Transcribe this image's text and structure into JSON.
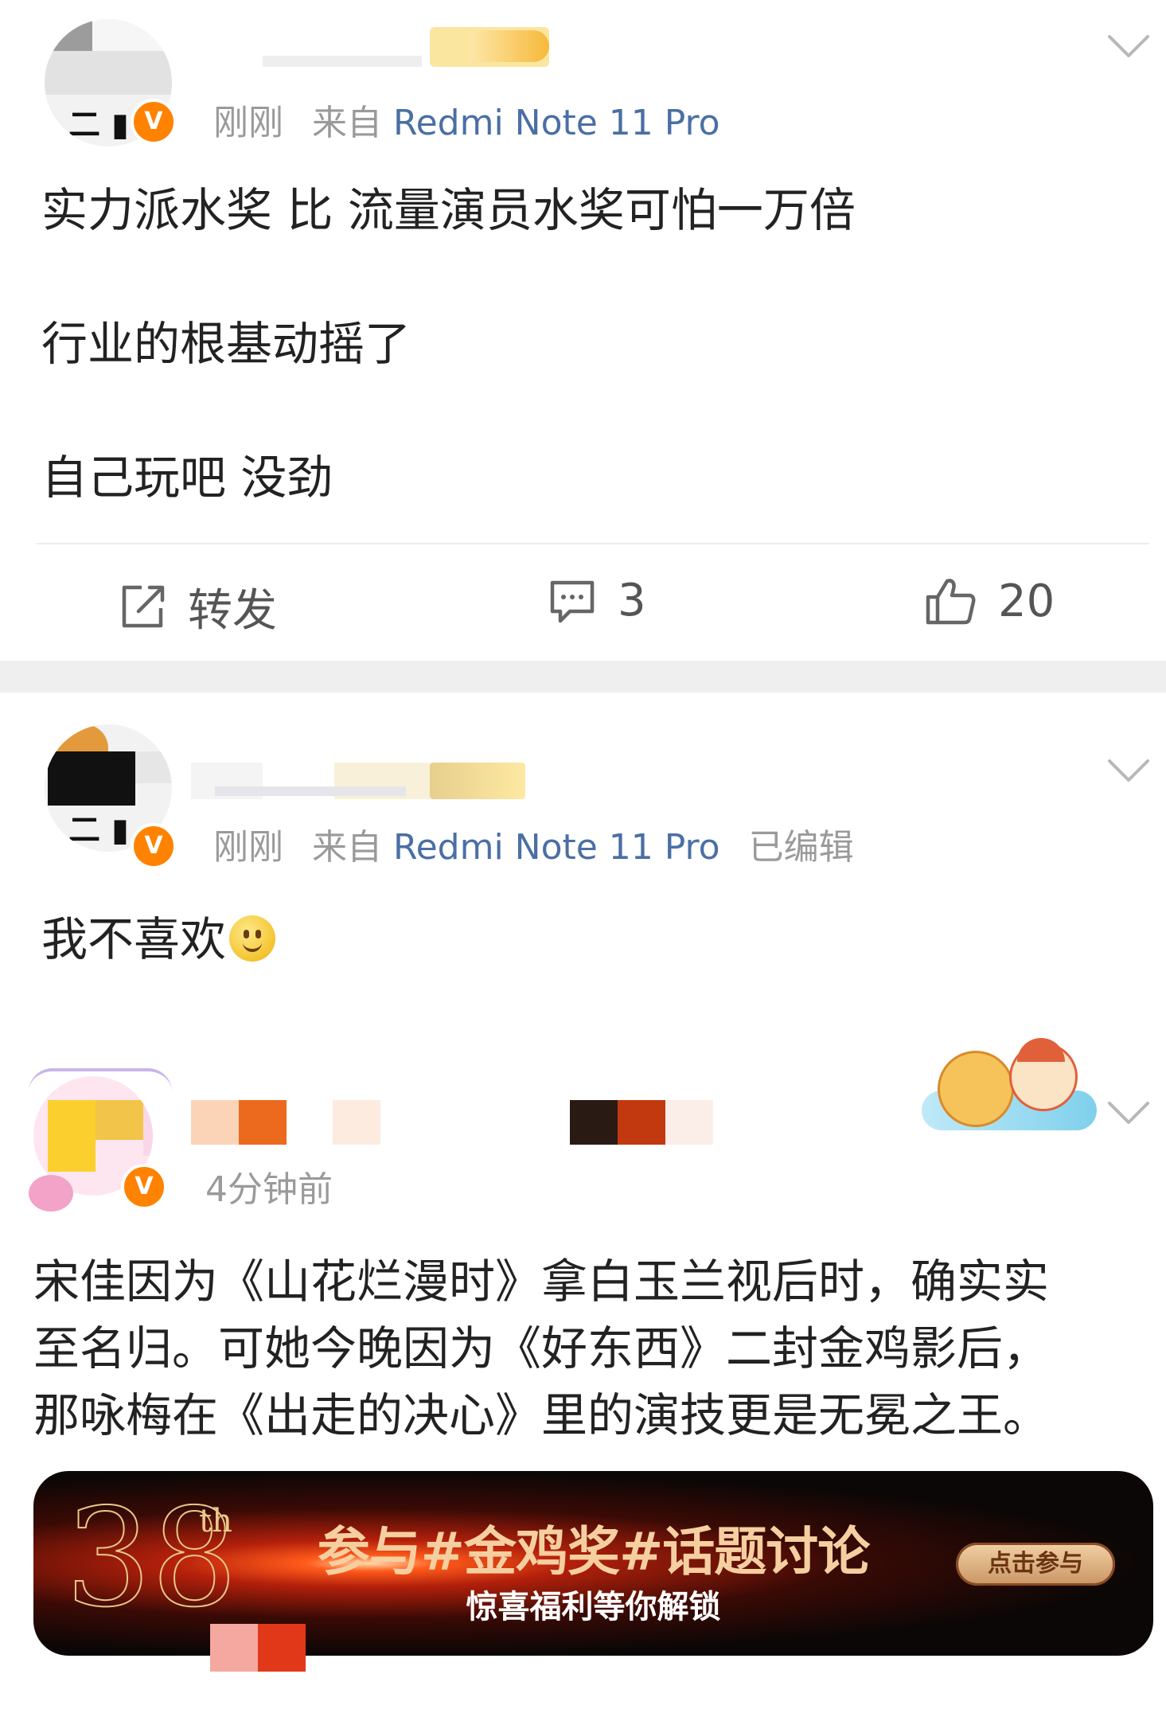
{
  "posts": [
    {
      "time": "刚刚",
      "source_prefix": "来自",
      "device": "Redmi Note 11 Pro",
      "edited": "",
      "body": [
        "实力派水奖 比  流量演员水奖可怕一万倍",
        "行业的根基动摇了",
        "自己玩吧 没劲"
      ],
      "actions": {
        "repost_label": "转发",
        "comment_count": "3",
        "like_count": "20"
      }
    },
    {
      "time": "刚刚",
      "source_prefix": "来自",
      "device": "Redmi Note 11 Pro",
      "edited": "已编辑",
      "body": [
        "我不喜欢"
      ]
    },
    {
      "time": "4分钟前",
      "body": [
        "宋佳因为《山花烂漫时》拿白玉兰视后时，确实实",
        "至名归。可她今晚因为《好东西》二封金鸡影后，",
        "那咏梅在《出走的决心》里的演技更是无冕之王。"
      ]
    }
  ],
  "banner": {
    "edition_number": "38",
    "edition_suffix": "th",
    "title": "参与#金鸡奖#话题讨论",
    "subtitle": "惊喜福利等你解锁",
    "cta": "点击参与"
  },
  "icons": [
    "verified-v-icon",
    "chevron-down-icon",
    "repost-icon",
    "comment-icon",
    "like-icon",
    "smile-emoji-icon",
    "dragon-boat-sticker-icon"
  ],
  "colors": {
    "accent": "#ff8200",
    "device_link": "#4a6fa5",
    "meta_gray": "#9a9a9a",
    "separator_band": "#efefef"
  }
}
